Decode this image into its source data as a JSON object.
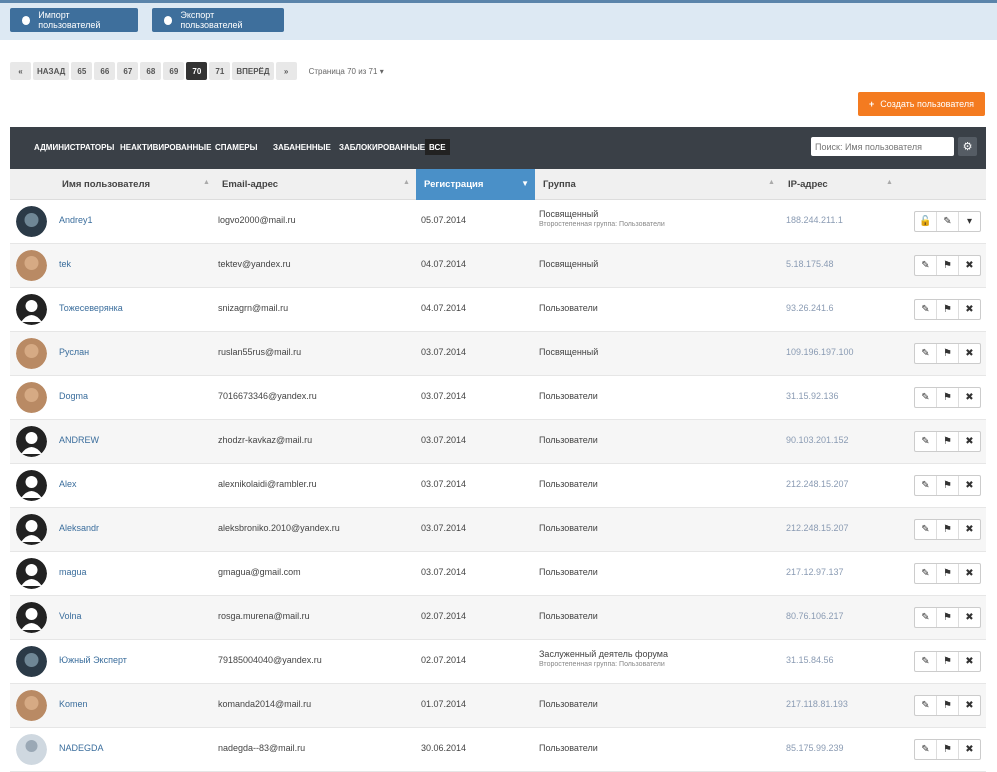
{
  "top": {
    "import_label": "Импорт пользователей",
    "export_label": "Экспорт пользователей"
  },
  "pager": {
    "first": "«",
    "back": "НАЗАД",
    "pages": [
      "65",
      "66",
      "67",
      "68",
      "69",
      "70",
      "71"
    ],
    "active_page": "70",
    "next": "ВПЕРЁД",
    "last": "»",
    "info": "Страница 70 из 71"
  },
  "create_label": "Создать пользователя",
  "filters": [
    "АДМИНИСТРАТОРЫ",
    "НЕАКТИВИРОВАННЫЕ",
    "СПАМЕРЫ",
    "ЗАБАНЕННЫЕ",
    "ЗАБЛОКИРОВАННЫЕ",
    "ВСЕ"
  ],
  "active_filter": "ВСЕ",
  "search_placeholder": "Поиск: Имя пользователя",
  "columns": {
    "username": "Имя пользователя",
    "email": "Email-адрес",
    "reg": "Регистрация",
    "group": "Группа",
    "ip": "IP-адрес"
  },
  "colors": {
    "accent": "#4a90c8",
    "create": "#f47b20",
    "topbtn": "#3e6f9c",
    "filterbar": "#3a4047"
  },
  "users": [
    {
      "name": "Andrey1",
      "email": "logvo2000@mail.ru",
      "reg": "05.07.2014",
      "group": "Посвященный",
      "sub": "Второстепенная группа: Пользователи",
      "ip": "188.244.211.1",
      "avatar": "photo-dark",
      "actions": [
        "unlock-icon",
        "pencil-icon",
        "chevron-down-icon"
      ]
    },
    {
      "name": "tek",
      "email": "tektev@yandex.ru",
      "reg": "04.07.2014",
      "group": "Посвященный",
      "sub": "",
      "ip": "5.18.175.48",
      "avatar": "photo-face",
      "actions": [
        "pencil-icon",
        "flag-icon",
        "close-icon"
      ]
    },
    {
      "name": "Тожесеверянка",
      "email": "snizagrn@mail.ru",
      "reg": "04.07.2014",
      "group": "Пользователи",
      "sub": "",
      "ip": "93.26.241.6",
      "avatar": "default",
      "actions": [
        "pencil-icon",
        "flag-icon",
        "close-icon"
      ]
    },
    {
      "name": "Руслан",
      "email": "ruslan55rus@mail.ru",
      "reg": "03.07.2014",
      "group": "Посвященный",
      "sub": "",
      "ip": "109.196.197.100",
      "avatar": "photo-face",
      "actions": [
        "pencil-icon",
        "flag-icon",
        "close-icon"
      ]
    },
    {
      "name": "Dogma",
      "email": "7016673346@yandex.ru",
      "reg": "03.07.2014",
      "group": "Пользователи",
      "sub": "",
      "ip": "31.15.92.136",
      "avatar": "photo-face",
      "actions": [
        "pencil-icon",
        "flag-icon",
        "close-icon"
      ]
    },
    {
      "name": "ANDREW",
      "email": "zhodzr-kavkaz@mail.ru",
      "reg": "03.07.2014",
      "group": "Пользователи",
      "sub": "",
      "ip": "90.103.201.152",
      "avatar": "default",
      "actions": [
        "pencil-icon",
        "flag-icon",
        "close-icon"
      ]
    },
    {
      "name": "Alex",
      "email": "alexnikolaidi@rambler.ru",
      "reg": "03.07.2014",
      "group": "Пользователи",
      "sub": "",
      "ip": "212.248.15.207",
      "avatar": "default",
      "actions": [
        "pencil-icon",
        "flag-icon",
        "close-icon"
      ]
    },
    {
      "name": "Aleksandr",
      "email": "aleksbroniko.2010@yandex.ru",
      "reg": "03.07.2014",
      "group": "Пользователи",
      "sub": "",
      "ip": "212.248.15.207",
      "avatar": "default",
      "actions": [
        "pencil-icon",
        "flag-icon",
        "close-icon"
      ]
    },
    {
      "name": "magua",
      "email": "gmagua@gmail.com",
      "reg": "03.07.2014",
      "group": "Пользователи",
      "sub": "",
      "ip": "217.12.97.137",
      "avatar": "default",
      "actions": [
        "pencil-icon",
        "flag-icon",
        "close-icon"
      ]
    },
    {
      "name": "Volna",
      "email": "rosga.murena@mail.ru",
      "reg": "02.07.2014",
      "group": "Пользователи",
      "sub": "",
      "ip": "80.76.106.217",
      "avatar": "default",
      "actions": [
        "pencil-icon",
        "flag-icon",
        "close-icon"
      ]
    },
    {
      "name": "Южный Эксперт",
      "email": "79185004040@yandex.ru",
      "reg": "02.07.2014",
      "group": "Заслуженный деятель форума",
      "sub": "Второстепенная группа: Пользователи",
      "ip": "31.15.84.56",
      "avatar": "photo-dark",
      "actions": [
        "pencil-icon",
        "flag-icon",
        "close-icon"
      ]
    },
    {
      "name": "Komen",
      "email": "komanda2014@mail.ru",
      "reg": "01.07.2014",
      "group": "Пользователи",
      "sub": "",
      "ip": "217.118.81.193",
      "avatar": "photo-face",
      "actions": [
        "pencil-icon",
        "flag-icon",
        "close-icon"
      ]
    },
    {
      "name": "NADEGDA",
      "email": "nadegda--83@mail.ru",
      "reg": "30.06.2014",
      "group": "Пользователи",
      "sub": "",
      "ip": "85.175.99.239",
      "avatar": "photo-light",
      "actions": [
        "pencil-icon",
        "flag-icon",
        "close-icon"
      ]
    }
  ]
}
